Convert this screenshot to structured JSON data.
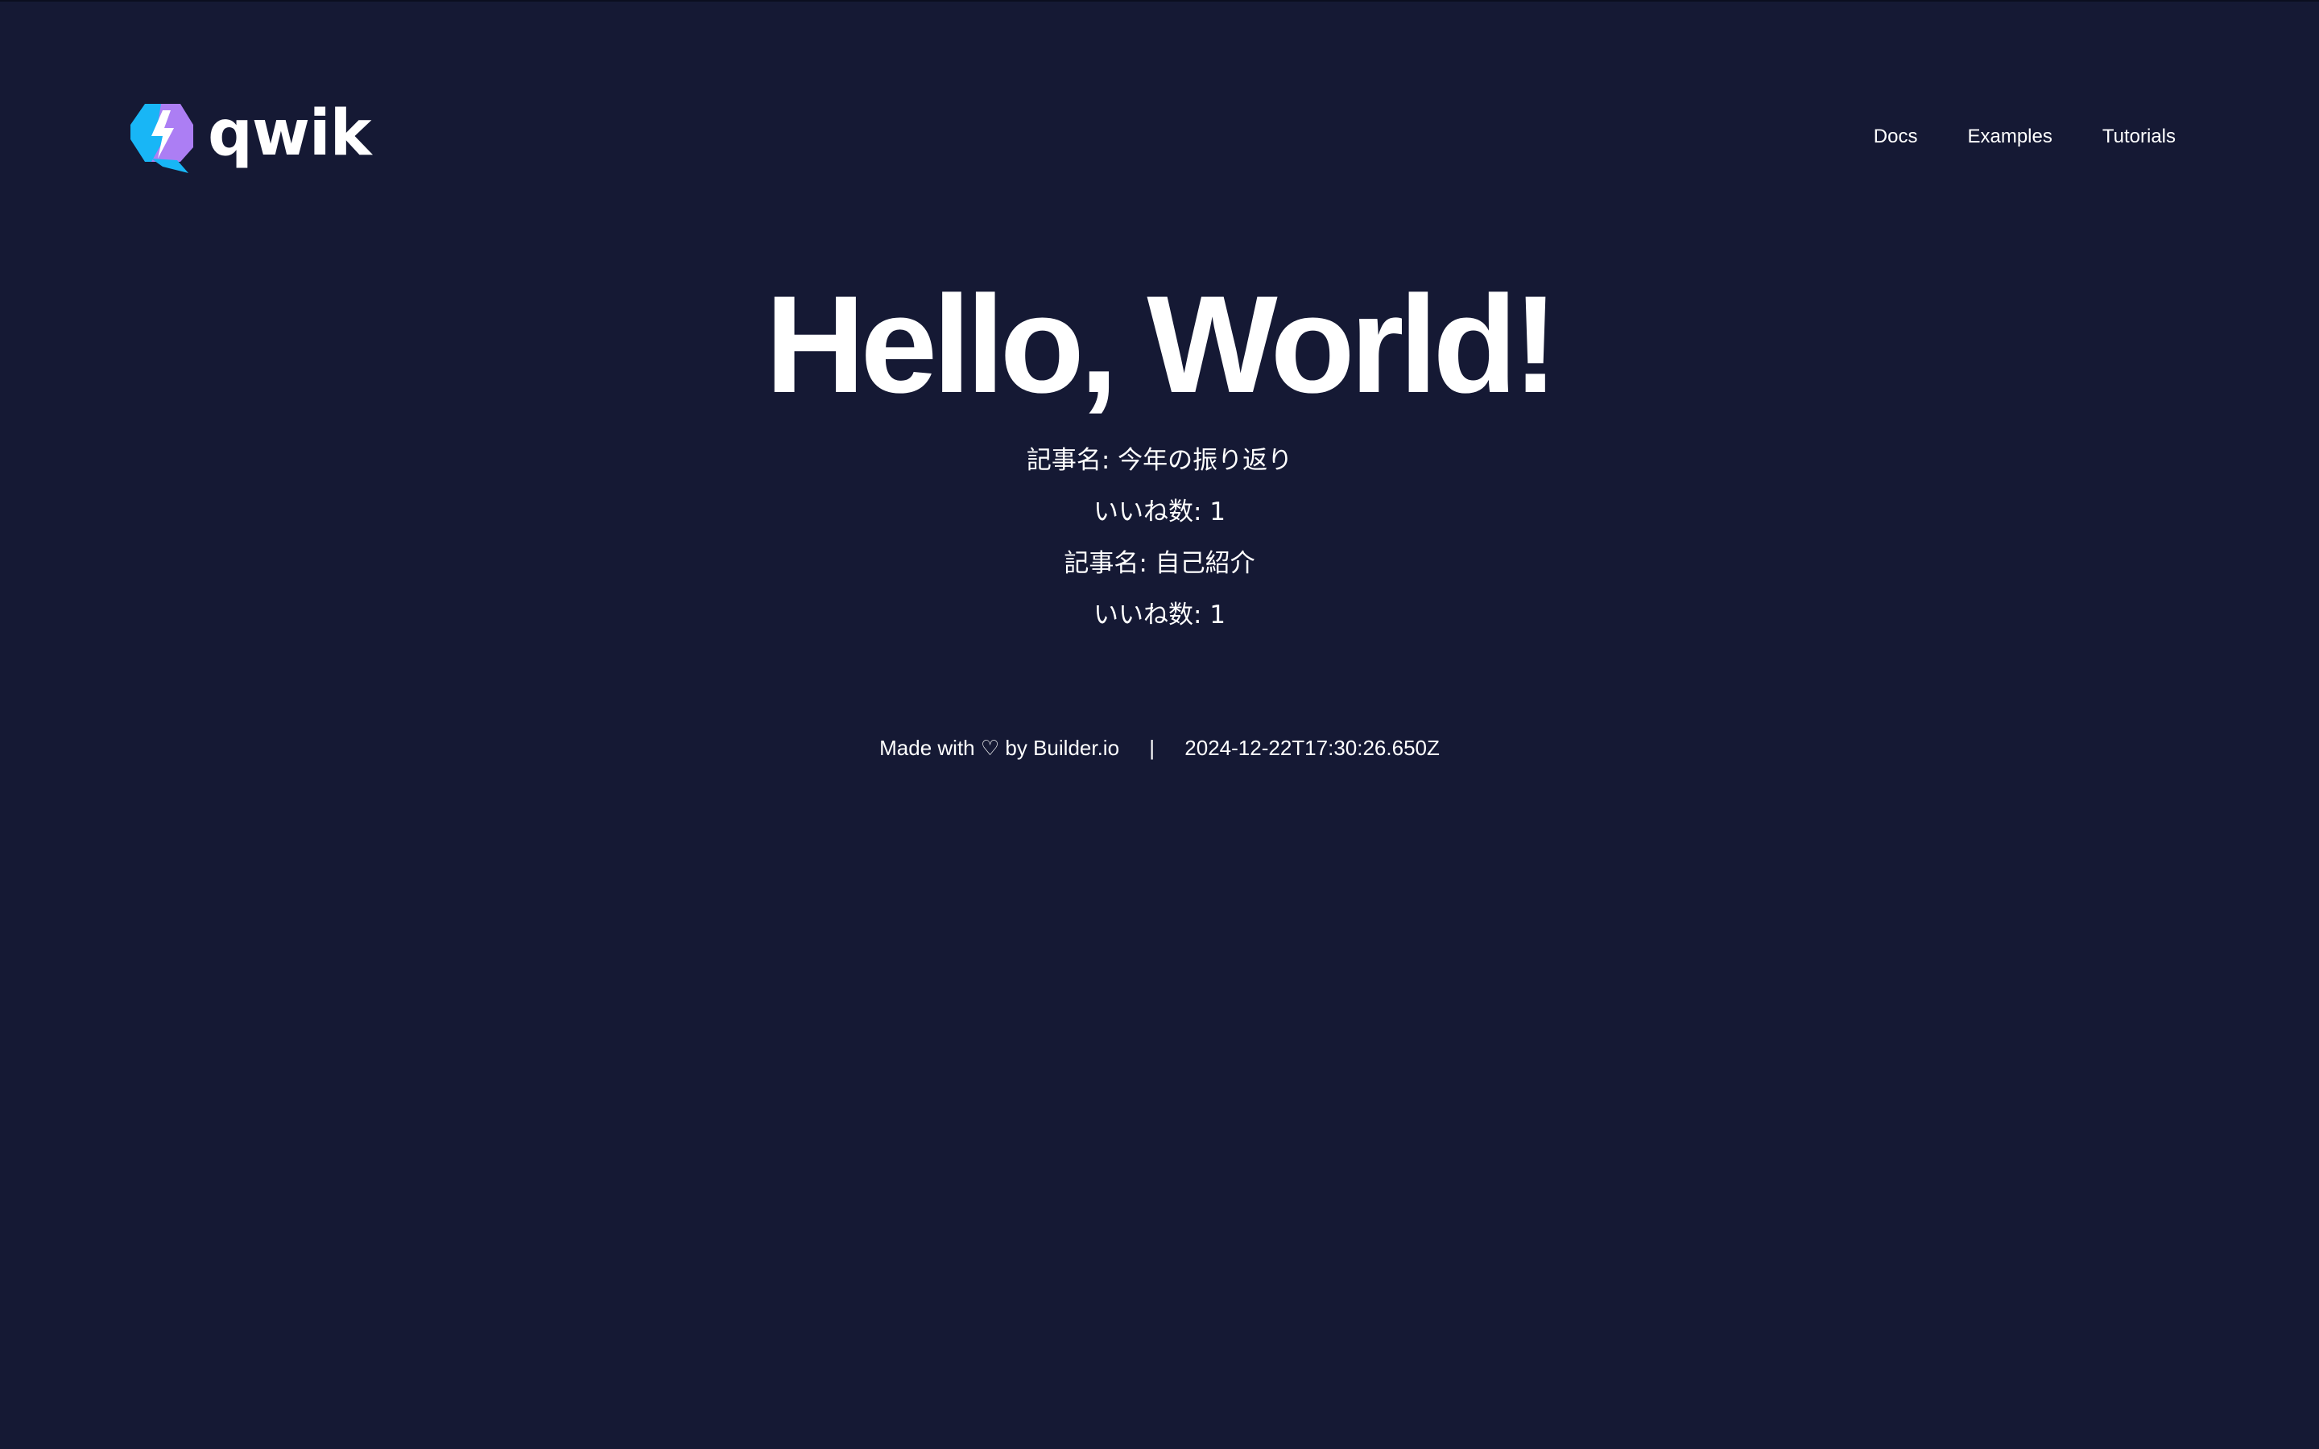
{
  "header": {
    "logo_text": "qwik",
    "logo_icon": "qwik-bolt-logo",
    "nav": [
      {
        "label": "Docs"
      },
      {
        "label": "Examples"
      },
      {
        "label": "Tutorials"
      }
    ]
  },
  "main": {
    "title": "Hello, World!",
    "articles": [
      {
        "title_line": "記事名: 今年の振り返り",
        "likes_line": "いいね数: 1"
      },
      {
        "title_line": "記事名: 自己紹介",
        "likes_line": "いいね数: 1"
      }
    ]
  },
  "footer": {
    "made_with": "Made with",
    "heart": "♡",
    "by": "by Builder.io",
    "separator": "|",
    "timestamp": "2024-12-22T17:30:26.650Z"
  },
  "colors": {
    "background": "#151934",
    "text": "#ffffff",
    "logo_purple": "#ac7ef4",
    "logo_blue": "#18b6f6"
  }
}
